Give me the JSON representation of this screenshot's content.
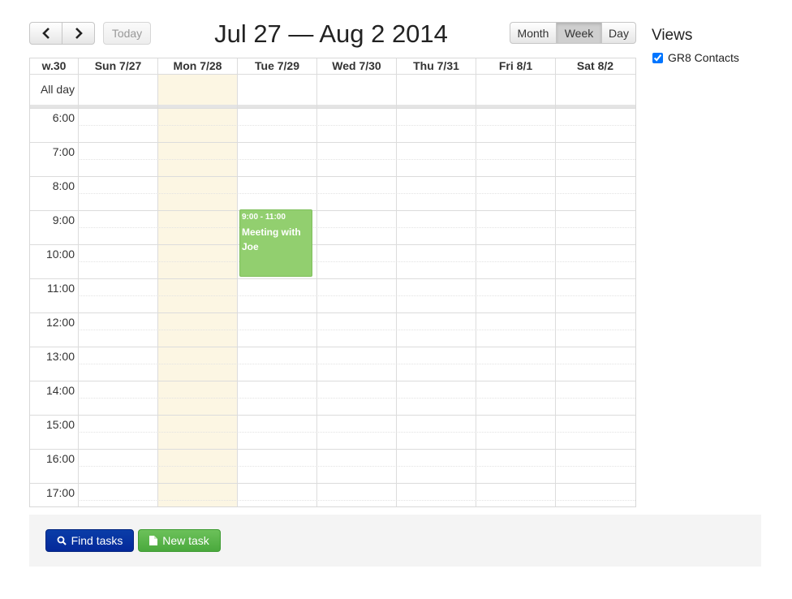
{
  "nav": {
    "prev_glyph": "‹",
    "next_glyph": "›",
    "today_label": "Today"
  },
  "title": "Jul 27 — Aug 2 2014",
  "view_modes": [
    {
      "label": "Month",
      "active": false
    },
    {
      "label": "Week",
      "active": true
    },
    {
      "label": "Day",
      "active": false
    }
  ],
  "calendar": {
    "week_label": "w.30",
    "days": [
      "Sun 7/27",
      "Mon 7/28",
      "Tue 7/29",
      "Wed 7/30",
      "Thu 7/31",
      "Fri 8/1",
      "Sat 8/2"
    ],
    "today_day": "Mon 7/28",
    "allday_label": "All day",
    "hours": [
      "6:00",
      "7:00",
      "8:00",
      "9:00",
      "10:00",
      "11:00",
      "12:00",
      "13:00",
      "14:00",
      "15:00",
      "16:00",
      "17:00"
    ]
  },
  "event": {
    "time": "9:00 - 11:00",
    "title": "Meeting with Joe",
    "day": "Tue 7/29",
    "color": "#92cf6f"
  },
  "sidebar": {
    "title": "Views",
    "items": [
      {
        "label": "GR8 Contacts",
        "checked": true
      }
    ]
  },
  "footer": {
    "find_label": "Find tasks",
    "find_icon": "search-icon",
    "new_label": "New task",
    "new_icon": "document-icon"
  },
  "colors": {
    "today_highlight": "#fcf6e3",
    "find_button": "#04299a",
    "new_button": "#4aa93d"
  }
}
